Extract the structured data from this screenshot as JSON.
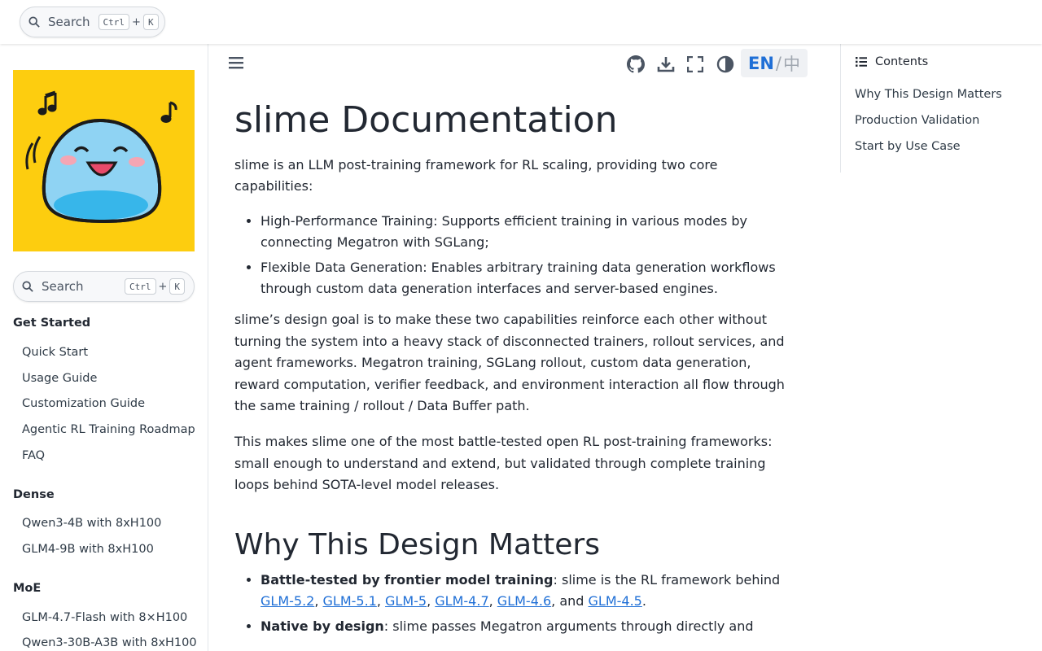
{
  "topbar": {
    "search_label": "Search",
    "kbd_ctrl": "Ctrl",
    "kbd_plus": "+",
    "kbd_k": "K"
  },
  "sidebar": {
    "search_label": "Search",
    "kbd_ctrl": "Ctrl",
    "kbd_plus": "+",
    "kbd_k": "K",
    "groups": [
      {
        "title": "Get Started",
        "items": [
          "Quick Start",
          "Usage Guide",
          "Customization Guide",
          "Agentic RL Training Roadmap",
          "FAQ"
        ]
      },
      {
        "title": "Dense",
        "items": [
          "Qwen3-4B with 8xH100",
          "GLM4-9B with 8xH100"
        ]
      },
      {
        "title": "MoE",
        "items": [
          "GLM-4.7-Flash with 8×H100",
          "Qwen3-30B-A3B with 8xH100"
        ]
      }
    ]
  },
  "toolbar": {
    "lang_en": "EN",
    "lang_sep": "/",
    "lang_zh": "中"
  },
  "icons": [
    "menu-icon",
    "github-icon",
    "download-icon",
    "fullscreen-icon",
    "theme-toggle-icon",
    "search-icon",
    "list-icon"
  ],
  "colors": {
    "accent": "#1f6fd6",
    "logo_bg": "#fdcd0f",
    "text": "#222832"
  },
  "article": {
    "title": "slime Documentation",
    "intro": "slime is an LLM post-training framework for RL scaling, providing two core capabilities:",
    "capabilities": [
      "High-Performance Training: Supports efficient training in various modes by connecting Megatron with SGLang;",
      "Flexible Data Generation: Enables arbitrary training data generation workflows through custom data generation interfaces and server-based engines."
    ],
    "para1": "slime’s design goal is to make these two capabilities reinforce each other without turning the system into a heavy stack of disconnected trainers, rollout services, and agent frameworks. Megatron training, SGLang rollout, custom data generation, reward computation, verifier feedback, and environment interaction all flow through the same training / rollout / Data Buffer path.",
    "para2": "This makes slime one of the most battle-tested open RL post-training frameworks: small enough to understand and extend, but validated through complete training loops behind SOTA-level model releases.",
    "section_title": "Why This Design Matters",
    "bullet1_bold": "Battle-tested by frontier model training",
    "bullet1_text": ": slime is the RL framework behind ",
    "bullet1_links": [
      "GLM-5.2",
      "GLM-5.1",
      "GLM-5",
      "GLM-4.7",
      "GLM-4.6",
      "GLM-4.5"
    ],
    "bullet1_sep": ", ",
    "bullet1_and": ", and ",
    "bullet1_end": ".",
    "bullet2_bold": "Native by design",
    "bullet2_text": ": slime passes Megatron arguments through directly and"
  },
  "toc": {
    "title": "Contents",
    "items": [
      "Why This Design Matters",
      "Production Validation",
      "Start by Use Case"
    ]
  }
}
